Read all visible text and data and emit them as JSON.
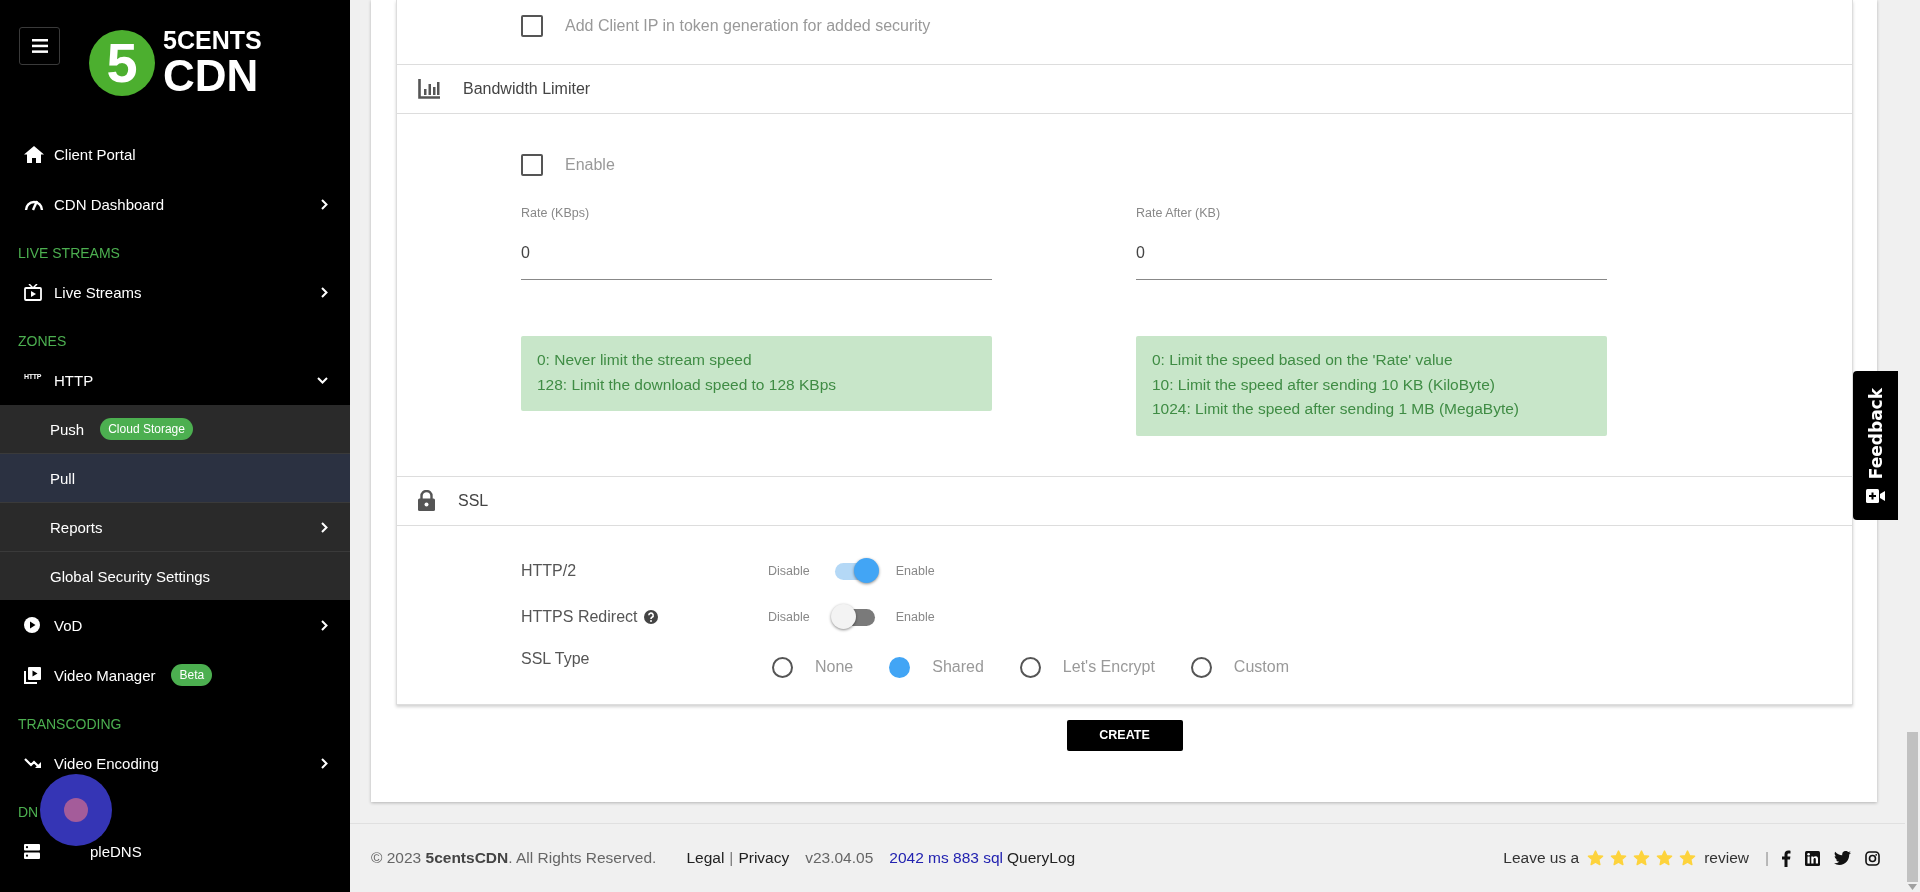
{
  "sidebar": {
    "logo": {
      "mark": "5",
      "line_1": "5CENTS",
      "line_2": "CDN"
    },
    "items": [
      {
        "kind": "item",
        "label": "Client Portal",
        "selected": false
      },
      {
        "kind": "item",
        "label": "CDN Dashboard",
        "selected": false,
        "expanded": false
      },
      {
        "kind": "section",
        "label": "LIVE STREAMS"
      },
      {
        "kind": "item",
        "label": "Live Streams",
        "selected": false,
        "expanded": false
      },
      {
        "kind": "section",
        "label": "ZONES"
      },
      {
        "kind": "item",
        "label": "HTTP",
        "icon_text": "HTTP",
        "selected": false,
        "expanded": true,
        "children": [
          {
            "label": "Push",
            "badge": "Cloud Storage",
            "selected": false
          },
          {
            "label": "Pull",
            "selected": true
          },
          {
            "label": "Reports",
            "selected": false,
            "expanded": false
          },
          {
            "label": "Global Security Settings",
            "selected": false
          }
        ]
      },
      {
        "kind": "item",
        "label": "VoD",
        "selected": false,
        "expanded": false
      },
      {
        "kind": "item",
        "label": "Video Manager",
        "badge": "Beta",
        "selected": false
      },
      {
        "kind": "section",
        "label": "TRANSCODING"
      },
      {
        "kind": "item",
        "label": "Video Encoding",
        "selected": false,
        "expanded": false
      },
      {
        "kind": "section",
        "label": "DN"
      },
      {
        "kind": "item",
        "label": "pleDNS",
        "selected": false
      }
    ]
  },
  "token_option": {
    "label": "Add Client IP in token generation for added security",
    "checked": false
  },
  "bandwidth_limiter": {
    "title": "Bandwidth Limiter",
    "enable": {
      "label": "Enable",
      "checked": false
    },
    "fields": [
      {
        "label": "Rate (KBps)",
        "value": "0",
        "hints": [
          "0: Never limit the stream speed",
          "128: Limit the download speed to 128 KBps"
        ]
      },
      {
        "label": "Rate After (KB)",
        "value": "0",
        "hints": [
          "0: Limit the speed based on the 'Rate' value",
          "10: Limit the speed after sending 10 KB (KiloByte)",
          "1024: Limit the speed after sending 1 MB (MegaByte)"
        ]
      }
    ]
  },
  "ssl": {
    "title": "SSL",
    "toggles": [
      {
        "label": "HTTP/2",
        "off_label": "Disable",
        "on_label": "Enable",
        "on": true,
        "help": false
      },
      {
        "label": "HTTPS Redirect",
        "off_label": "Disable",
        "on_label": "Enable",
        "on": false,
        "help": true
      }
    ],
    "ssl_type": {
      "label": "SSL Type",
      "options": [
        {
          "label": "None",
          "selected": false
        },
        {
          "label": "Shared",
          "selected": true
        },
        {
          "label": "Let's Encrypt",
          "selected": false
        },
        {
          "label": "Custom",
          "selected": false
        }
      ]
    }
  },
  "create_button": "CREATE",
  "footer": {
    "copyright": "© 2023 **5centsCDN**. All Rights Reserved.",
    "links": [
      "Legal",
      "Privacy"
    ],
    "link_separator": "|",
    "version": "v23.04.05",
    "timing": "2042 ms 883 sql",
    "query_log": "QueryLog",
    "review": {
      "before": "Leave us a",
      "stars": 5,
      "after": "review"
    },
    "separator": "|"
  },
  "feedback_tab": {
    "label": "Feedback"
  }
}
